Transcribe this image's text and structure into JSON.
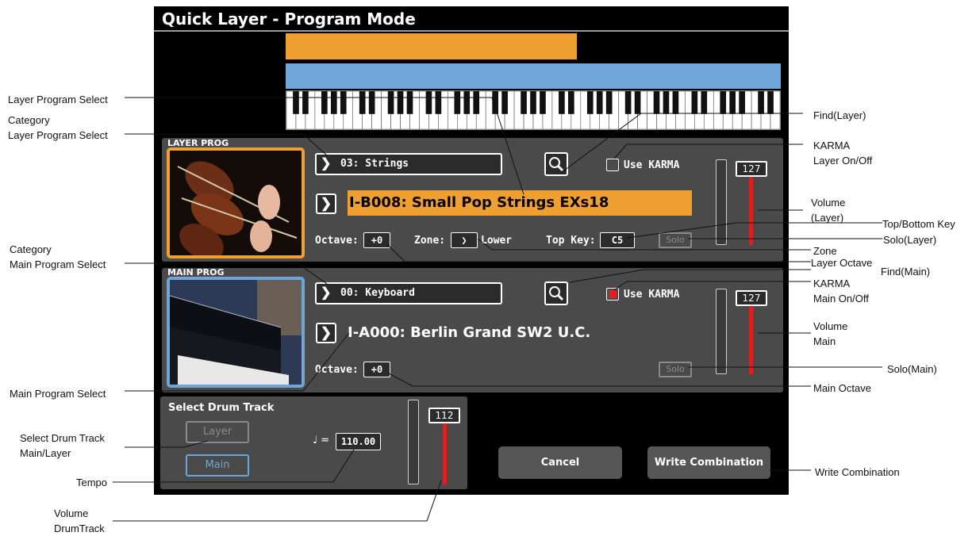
{
  "window": {
    "title": "Quick Layer - Program Mode"
  },
  "layer": {
    "label": "LAYER PROG",
    "category": "03: Strings",
    "program": "I-B008: Small Pop Strings EXs18",
    "octave_label": "Octave:",
    "octave_value": "+0",
    "zone_label": "Zone:",
    "zone_value": "Lower",
    "top_key_label": "Top Key:",
    "top_key_value": "C5",
    "karma_label": "Use KARMA",
    "karma_on": false,
    "solo_label": "Solo",
    "volume": "127",
    "colors": {
      "accent": "#F0A030"
    }
  },
  "main": {
    "label": "MAIN PROG",
    "category": "00: Keyboard",
    "program": "I-A000: Berlin Grand SW2 U.C.",
    "octave_label": "Octave:",
    "octave_value": "+0",
    "karma_label": "Use KARMA",
    "karma_on": true,
    "solo_label": "Solo",
    "volume": "127",
    "colors": {
      "accent": "#6EA6DA"
    }
  },
  "drum": {
    "label": "Select Drum Track",
    "layer_btn": "Layer",
    "main_btn": "Main",
    "tempo_symbol": "♩ =",
    "tempo": "110.00",
    "volume": "112"
  },
  "buttons": {
    "cancel": "Cancel",
    "write": "Write Combination"
  },
  "callouts": {
    "left": [
      "Layer Program Select",
      "Category",
      "Layer Program Select",
      "Category",
      "Main Program Select",
      "Main Program Select",
      "Select Drum Track",
      "Main/Layer",
      "Tempo",
      "Volume",
      "DrumTrack"
    ],
    "right": [
      "Find(Layer)",
      "KARMA",
      "Layer On/Off",
      "Volume",
      "(Layer)",
      "Top/Bottom Key",
      "Solo(Layer)",
      "Zone",
      "Layer Octave",
      "Find(Main)",
      "KARMA",
      "Main On/Off",
      "Volume",
      "Main",
      "Solo(Main)",
      "Main Octave",
      "Write Combination"
    ]
  },
  "icons": [
    "search-icon",
    "chevron-right-icon",
    "quarter-note-icon",
    "strings-photo",
    "piano-photo"
  ]
}
